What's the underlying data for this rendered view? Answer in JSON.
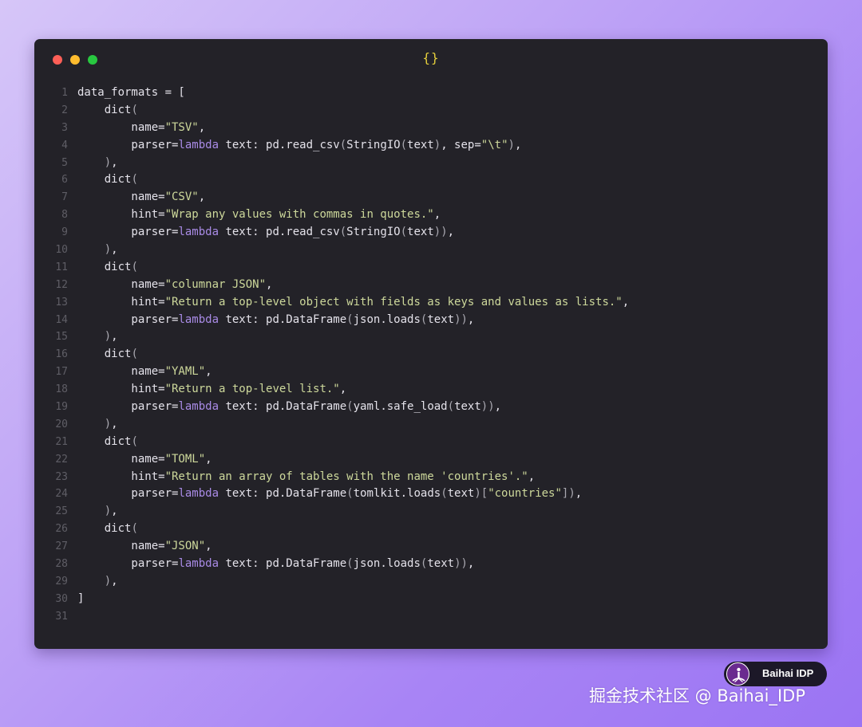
{
  "window": {
    "title_icon": "{}",
    "traffic_lights": [
      "close-button",
      "minimize-button",
      "maximize-button"
    ]
  },
  "code_lines": [
    [
      {
        "t": "data_formats = ["
      }
    ],
    [
      {
        "t": "    dict"
      },
      {
        "t": "(",
        "c": "punc"
      }
    ],
    [
      {
        "t": "        name="
      },
      {
        "t": "\"TSV\"",
        "c": "str"
      },
      {
        "t": ","
      }
    ],
    [
      {
        "t": "        parser="
      },
      {
        "t": "lambda",
        "c": "kw"
      },
      {
        "t": " text: pd.read_csv"
      },
      {
        "t": "(",
        "c": "punc"
      },
      {
        "t": "StringIO"
      },
      {
        "t": "(",
        "c": "punc"
      },
      {
        "t": "text"
      },
      {
        "t": ")",
        "c": "punc"
      },
      {
        "t": ", sep="
      },
      {
        "t": "\"\\t\"",
        "c": "str"
      },
      {
        "t": ")",
        "c": "punc"
      },
      {
        "t": ","
      }
    ],
    [
      {
        "t": "    "
      },
      {
        "t": ")",
        "c": "punc"
      },
      {
        "t": ","
      }
    ],
    [
      {
        "t": "    dict"
      },
      {
        "t": "(",
        "c": "punc"
      }
    ],
    [
      {
        "t": "        name="
      },
      {
        "t": "\"CSV\"",
        "c": "str"
      },
      {
        "t": ","
      }
    ],
    [
      {
        "t": "        hint="
      },
      {
        "t": "\"Wrap any values with commas in quotes.\"",
        "c": "str"
      },
      {
        "t": ","
      }
    ],
    [
      {
        "t": "        parser="
      },
      {
        "t": "lambda",
        "c": "kw"
      },
      {
        "t": " text: pd.read_csv"
      },
      {
        "t": "(",
        "c": "punc"
      },
      {
        "t": "StringIO"
      },
      {
        "t": "(",
        "c": "punc"
      },
      {
        "t": "text"
      },
      {
        "t": "))",
        "c": "punc"
      },
      {
        "t": ","
      }
    ],
    [
      {
        "t": "    "
      },
      {
        "t": ")",
        "c": "punc"
      },
      {
        "t": ","
      }
    ],
    [
      {
        "t": "    dict"
      },
      {
        "t": "(",
        "c": "punc"
      }
    ],
    [
      {
        "t": "        name="
      },
      {
        "t": "\"columnar JSON\"",
        "c": "str"
      },
      {
        "t": ","
      }
    ],
    [
      {
        "t": "        hint="
      },
      {
        "t": "\"Return a top-level object with fields as keys and values as lists.\"",
        "c": "str"
      },
      {
        "t": ","
      }
    ],
    [
      {
        "t": "        parser="
      },
      {
        "t": "lambda",
        "c": "kw"
      },
      {
        "t": " text: pd.DataFrame"
      },
      {
        "t": "(",
        "c": "punc"
      },
      {
        "t": "json.loads"
      },
      {
        "t": "(",
        "c": "punc"
      },
      {
        "t": "text"
      },
      {
        "t": "))",
        "c": "punc"
      },
      {
        "t": ","
      }
    ],
    [
      {
        "t": "    "
      },
      {
        "t": ")",
        "c": "punc"
      },
      {
        "t": ","
      }
    ],
    [
      {
        "t": "    dict"
      },
      {
        "t": "(",
        "c": "punc"
      }
    ],
    [
      {
        "t": "        name="
      },
      {
        "t": "\"YAML\"",
        "c": "str"
      },
      {
        "t": ","
      }
    ],
    [
      {
        "t": "        hint="
      },
      {
        "t": "\"Return a top-level list.\"",
        "c": "str"
      },
      {
        "t": ","
      }
    ],
    [
      {
        "t": "        parser="
      },
      {
        "t": "lambda",
        "c": "kw"
      },
      {
        "t": " text: pd.DataFrame"
      },
      {
        "t": "(",
        "c": "punc"
      },
      {
        "t": "yaml.safe_load"
      },
      {
        "t": "(",
        "c": "punc"
      },
      {
        "t": "text"
      },
      {
        "t": "))",
        "c": "punc"
      },
      {
        "t": ","
      }
    ],
    [
      {
        "t": "    "
      },
      {
        "t": ")",
        "c": "punc"
      },
      {
        "t": ","
      }
    ],
    [
      {
        "t": "    dict"
      },
      {
        "t": "(",
        "c": "punc"
      }
    ],
    [
      {
        "t": "        name="
      },
      {
        "t": "\"TOML\"",
        "c": "str"
      },
      {
        "t": ","
      }
    ],
    [
      {
        "t": "        hint="
      },
      {
        "t": "\"Return an array of tables with the name 'countries'.\"",
        "c": "str"
      },
      {
        "t": ","
      }
    ],
    [
      {
        "t": "        parser="
      },
      {
        "t": "lambda",
        "c": "kw"
      },
      {
        "t": " text: pd.DataFrame"
      },
      {
        "t": "(",
        "c": "punc"
      },
      {
        "t": "tomlkit.loads"
      },
      {
        "t": "(",
        "c": "punc"
      },
      {
        "t": "text"
      },
      {
        "t": ")[",
        "c": "punc"
      },
      {
        "t": "\"countries\"",
        "c": "str"
      },
      {
        "t": "])",
        "c": "punc"
      },
      {
        "t": ","
      }
    ],
    [
      {
        "t": "    "
      },
      {
        "t": ")",
        "c": "punc"
      },
      {
        "t": ","
      }
    ],
    [
      {
        "t": "    dict"
      },
      {
        "t": "(",
        "c": "punc"
      }
    ],
    [
      {
        "t": "        name="
      },
      {
        "t": "\"JSON\"",
        "c": "str"
      },
      {
        "t": ","
      }
    ],
    [
      {
        "t": "        parser="
      },
      {
        "t": "lambda",
        "c": "kw"
      },
      {
        "t": " text: pd.DataFrame"
      },
      {
        "t": "(",
        "c": "punc"
      },
      {
        "t": "json.loads"
      },
      {
        "t": "(",
        "c": "punc"
      },
      {
        "t": "text"
      },
      {
        "t": "))",
        "c": "punc"
      },
      {
        "t": ","
      }
    ],
    [
      {
        "t": "    "
      },
      {
        "t": ")",
        "c": "punc"
      },
      {
        "t": ","
      }
    ],
    [
      {
        "t": "]"
      }
    ],
    []
  ],
  "badge": {
    "label": "Baihai IDP",
    "icon": "baihai-logo-icon"
  },
  "watermark": "掘金技术社区 @ Baihai_IDP",
  "colors": {
    "background": "#a884f5",
    "editor": "#232228",
    "string": "#cdd89b",
    "keyword": "#a98be6",
    "line_number": "#5f5e66",
    "title_glyph": "#e5cf3c"
  }
}
